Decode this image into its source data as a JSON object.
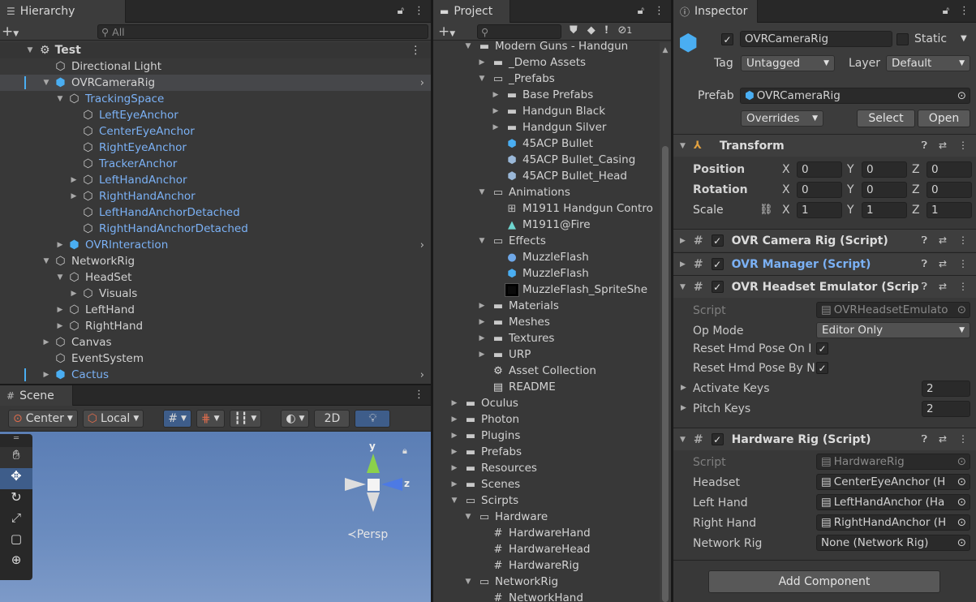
{
  "hierarchy": {
    "tab": "Hierarchy",
    "search_placeholder": "All",
    "scene": "Test",
    "rows": [
      {
        "label": "Directional Light",
        "indent": 1,
        "arrow": "",
        "blue": false,
        "sel": false,
        "prefab": false
      },
      {
        "label": "OVRCameraRig",
        "indent": 1,
        "arrow": "▼",
        "blue": false,
        "sel": true,
        "prefab": true,
        "chev": true
      },
      {
        "label": "TrackingSpace",
        "indent": 2,
        "arrow": "▼",
        "blue": true,
        "sel": false,
        "prefab": false
      },
      {
        "label": "LeftEyeAnchor",
        "indent": 3,
        "arrow": "",
        "blue": true,
        "sel": false,
        "prefab": false
      },
      {
        "label": "CenterEyeAnchor",
        "indent": 3,
        "arrow": "",
        "blue": true,
        "sel": false,
        "prefab": false
      },
      {
        "label": "RightEyeAnchor",
        "indent": 3,
        "arrow": "",
        "blue": true,
        "sel": false,
        "prefab": false
      },
      {
        "label": "TrackerAnchor",
        "indent": 3,
        "arrow": "",
        "blue": true,
        "sel": false,
        "prefab": false
      },
      {
        "label": "LeftHandAnchor",
        "indent": 3,
        "arrow": "▶",
        "blue": true,
        "sel": false,
        "prefab": false
      },
      {
        "label": "RightHandAnchor",
        "indent": 3,
        "arrow": "▶",
        "blue": true,
        "sel": false,
        "prefab": false
      },
      {
        "label": "LeftHandAnchorDetached",
        "indent": 3,
        "arrow": "",
        "blue": true,
        "sel": false,
        "prefab": false
      },
      {
        "label": "RightHandAnchorDetached",
        "indent": 3,
        "arrow": "",
        "blue": true,
        "sel": false,
        "prefab": false
      },
      {
        "label": "OVRInteraction",
        "indent": 2,
        "arrow": "▶",
        "blue": true,
        "sel": false,
        "prefab": true,
        "chev": true
      },
      {
        "label": "NetworkRig",
        "indent": 1,
        "arrow": "▼",
        "blue": false,
        "sel": false,
        "prefab": false
      },
      {
        "label": "HeadSet",
        "indent": 2,
        "arrow": "▼",
        "blue": false,
        "sel": false,
        "prefab": false
      },
      {
        "label": "Visuals",
        "indent": 3,
        "arrow": "▶",
        "blue": false,
        "sel": false,
        "prefab": false
      },
      {
        "label": "LeftHand",
        "indent": 2,
        "arrow": "▶",
        "blue": false,
        "sel": false,
        "prefab": false
      },
      {
        "label": "RightHand",
        "indent": 2,
        "arrow": "▶",
        "blue": false,
        "sel": false,
        "prefab": false
      },
      {
        "label": "Canvas",
        "indent": 1,
        "arrow": "▶",
        "blue": false,
        "sel": false,
        "prefab": false
      },
      {
        "label": "EventSystem",
        "indent": 1,
        "arrow": "",
        "blue": false,
        "sel": false,
        "prefab": false
      },
      {
        "label": "Cactus",
        "indent": 1,
        "arrow": "▶",
        "blue": true,
        "sel": false,
        "prefab": true,
        "chev": true
      }
    ]
  },
  "scene": {
    "tab": "Scene",
    "pivot": "Center",
    "space": "Local",
    "mode_2d": "2D",
    "persp": "Persp",
    "axis_y": "y",
    "axis_z": "z"
  },
  "project": {
    "tab": "Project",
    "badge": "1",
    "rows": [
      {
        "label": "Modern Guns - Handgun",
        "indent": 2,
        "arrow": "▼",
        "icon": "folder"
      },
      {
        "label": "_Demo Assets",
        "indent": 3,
        "arrow": "▶",
        "icon": "folder"
      },
      {
        "label": "_Prefabs",
        "indent": 3,
        "arrow": "▼",
        "icon": "folder-open"
      },
      {
        "label": "Base Prefabs",
        "indent": 4,
        "arrow": "▶",
        "icon": "folder"
      },
      {
        "label": "Handgun Black",
        "indent": 4,
        "arrow": "▶",
        "icon": "folder"
      },
      {
        "label": "Handgun Silver",
        "indent": 4,
        "arrow": "▶",
        "icon": "folder"
      },
      {
        "label": "45ACP Bullet",
        "indent": 4,
        "arrow": "",
        "icon": "prefab"
      },
      {
        "label": "45ACP Bullet_Casing",
        "indent": 4,
        "arrow": "",
        "icon": "prefab-variant"
      },
      {
        "label": "45ACP Bullet_Head",
        "indent": 4,
        "arrow": "",
        "icon": "prefab-variant"
      },
      {
        "label": "Animations",
        "indent": 3,
        "arrow": "▼",
        "icon": "folder-open"
      },
      {
        "label": "M1911 Handgun Contro",
        "indent": 4,
        "arrow": "",
        "icon": "animator"
      },
      {
        "label": "M1911@Fire",
        "indent": 4,
        "arrow": "",
        "icon": "animation"
      },
      {
        "label": "Effects",
        "indent": 3,
        "arrow": "▼",
        "icon": "folder-open"
      },
      {
        "label": "MuzzleFlash",
        "indent": 4,
        "arrow": "",
        "icon": "material"
      },
      {
        "label": "MuzzleFlash",
        "indent": 4,
        "arrow": "",
        "icon": "prefab"
      },
      {
        "label": "MuzzleFlash_SpriteShe",
        "indent": 4,
        "arrow": "",
        "icon": "texture"
      },
      {
        "label": "Materials",
        "indent": 3,
        "arrow": "▶",
        "icon": "folder"
      },
      {
        "label": "Meshes",
        "indent": 3,
        "arrow": "▶",
        "icon": "folder"
      },
      {
        "label": "Textures",
        "indent": 3,
        "arrow": "▶",
        "icon": "folder"
      },
      {
        "label": "URP",
        "indent": 3,
        "arrow": "▶",
        "icon": "folder"
      },
      {
        "label": "Asset Collection",
        "indent": 3,
        "arrow": "",
        "icon": "unity"
      },
      {
        "label": "README",
        "indent": 3,
        "arrow": "",
        "icon": "text"
      },
      {
        "label": "Oculus",
        "indent": 1,
        "arrow": "▶",
        "icon": "folder"
      },
      {
        "label": "Photon",
        "indent": 1,
        "arrow": "▶",
        "icon": "folder"
      },
      {
        "label": "Plugins",
        "indent": 1,
        "arrow": "▶",
        "icon": "folder"
      },
      {
        "label": "Prefabs",
        "indent": 1,
        "arrow": "▶",
        "icon": "folder"
      },
      {
        "label": "Resources",
        "indent": 1,
        "arrow": "▶",
        "icon": "folder"
      },
      {
        "label": "Scenes",
        "indent": 1,
        "arrow": "▶",
        "icon": "folder"
      },
      {
        "label": "Scirpts",
        "indent": 1,
        "arrow": "▼",
        "icon": "folder-open"
      },
      {
        "label": "Hardware",
        "indent": 2,
        "arrow": "▼",
        "icon": "folder-open"
      },
      {
        "label": "HardwareHand",
        "indent": 3,
        "arrow": "",
        "icon": "script"
      },
      {
        "label": "HardwareHead",
        "indent": 3,
        "arrow": "",
        "icon": "script"
      },
      {
        "label": "HardwareRig",
        "indent": 3,
        "arrow": "",
        "icon": "script"
      },
      {
        "label": "NetworkRig",
        "indent": 2,
        "arrow": "▼",
        "icon": "folder-open"
      },
      {
        "label": "NetworkHand",
        "indent": 3,
        "arrow": "",
        "icon": "script"
      }
    ]
  },
  "inspector": {
    "tab": "Inspector",
    "object_name": "OVRCameraRig",
    "static_label": "Static",
    "tag_label": "Tag",
    "tag_value": "Untagged",
    "layer_label": "Layer",
    "layer_value": "Default",
    "prefab_label": "Prefab",
    "prefab_value": "OVRCameraRig",
    "overrides": "Overrides",
    "select": "Select",
    "open": "Open",
    "transform": {
      "title": "Transform",
      "position_label": "Position",
      "rotation_label": "Rotation",
      "scale_label": "Scale",
      "x": "X",
      "y": "Y",
      "z": "Z",
      "position": [
        "0",
        "0",
        "0"
      ],
      "rotation": [
        "0",
        "0",
        "0"
      ],
      "scale": [
        "1",
        "1",
        "1"
      ]
    },
    "ovr_camera_rig": "OVR Camera Rig (Script)",
    "ovr_manager": "OVR Manager (Script)",
    "headset_emulator": {
      "title": "OVR Headset Emulator (Scrip",
      "script_label": "Script",
      "script_value": "OVRHeadsetEmulato",
      "op_mode_label": "Op Mode",
      "op_mode_value": "Editor Only",
      "reset_on_label": "Reset Hmd Pose On I",
      "reset_by_label": "Reset Hmd Pose By N",
      "activate_keys_label": "Activate Keys",
      "activate_keys_value": "2",
      "pitch_keys_label": "Pitch Keys",
      "pitch_keys_value": "2"
    },
    "hardware_rig": {
      "title": "Hardware Rig (Script)",
      "script_label": "Script",
      "script_value": "HardwareRig",
      "headset_label": "Headset",
      "headset_value": "CenterEyeAnchor (H",
      "left_hand_label": "Left Hand",
      "left_hand_value": "LeftHandAnchor (Ha",
      "right_hand_label": "Right Hand",
      "right_hand_value": "RightHandAnchor (H",
      "network_rig_label": "Network Rig",
      "network_rig_value": "None (Network Rig)"
    },
    "add_component": "Add Component"
  }
}
